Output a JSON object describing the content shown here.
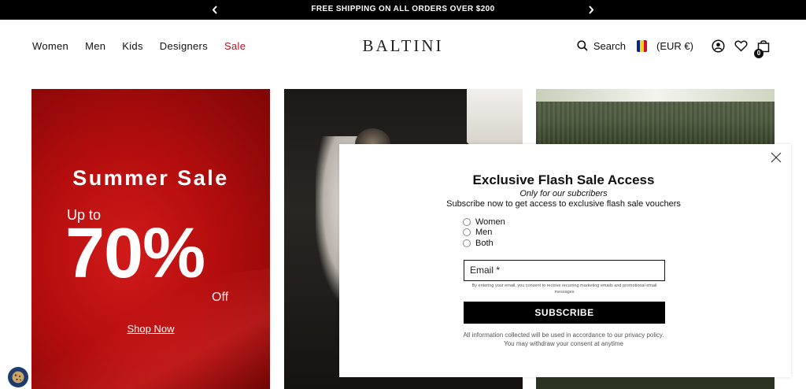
{
  "announcement": {
    "message": "FREE SHIPPING ON ALL ORDERS OVER $200",
    "prev_icon": "chevron-left-icon",
    "next_icon": "chevron-right-icon"
  },
  "header": {
    "logo": "BALTINI",
    "nav": [
      {
        "label": "Women"
      },
      {
        "label": "Men"
      },
      {
        "label": "Kids"
      },
      {
        "label": "Designers"
      },
      {
        "label": "Sale"
      }
    ],
    "search_label": "Search",
    "currency": "(EUR €)",
    "cart_count": "0",
    "flag_colors": [
      "#002b7f",
      "#fcd116",
      "#ce1126"
    ]
  },
  "promo": {
    "title": "Summer Sale",
    "upto": "Up to",
    "percent": "70%",
    "off": "Off",
    "cta": "Shop Now"
  },
  "popup": {
    "title": "Exclusive Flash Sale Access",
    "subtitle": "Only for our subcribers",
    "description": "Subscribe now to get access to exclusive flash sale vouchers",
    "options": [
      {
        "label": "Women"
      },
      {
        "label": "Men"
      },
      {
        "label": "Both"
      }
    ],
    "email_placeholder": "Email *",
    "consent": "By entering your email, you consent to receive recurring marketing emails and promotional email messages",
    "subscribe_label": "SUBSCRIBE",
    "info_line1": "All information collected will be used in accordance to our privacy policy.",
    "info_line2": "You may withdraw your consent at anytime"
  },
  "colors": {
    "sale_nav": "#b3141b",
    "promo_red": "#c21212",
    "cookie_bg": "#1d3b6e"
  }
}
